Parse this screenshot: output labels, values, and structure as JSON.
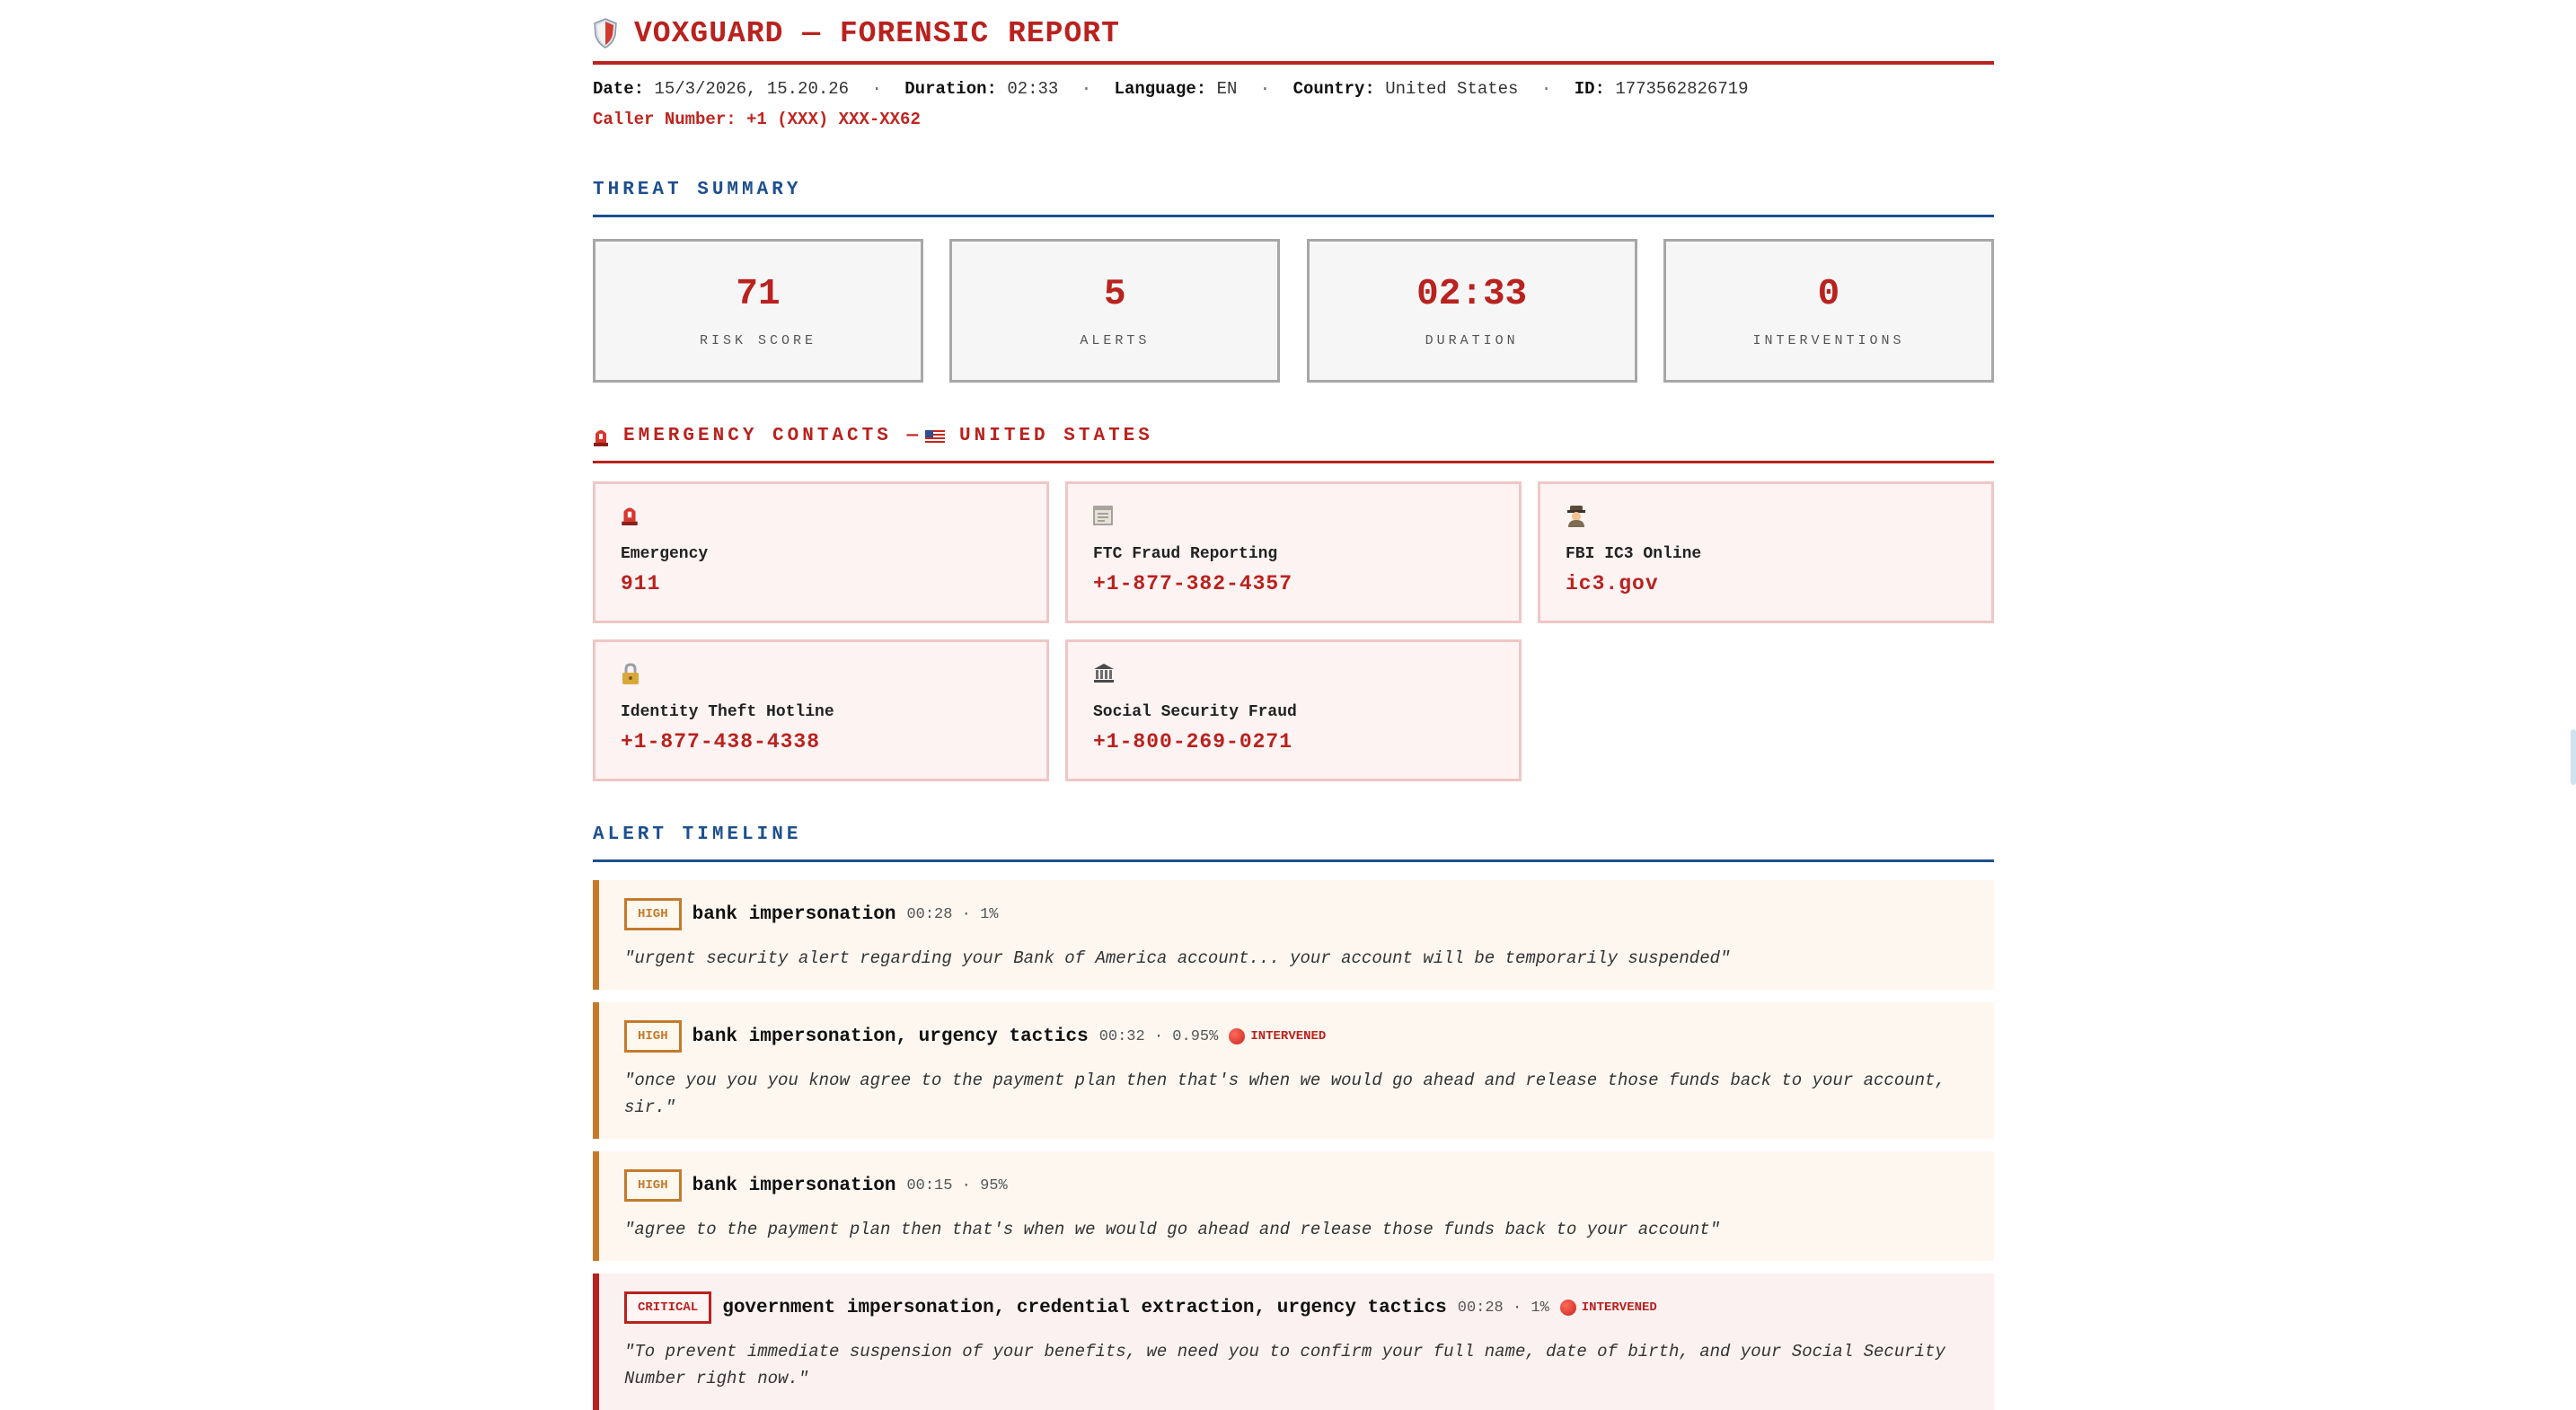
{
  "header": {
    "title": "VOXGUARD — FORENSIC REPORT",
    "meta": [
      {
        "label": "Date:",
        "value": "15/3/2026, 15.20.26"
      },
      {
        "label": "Duration:",
        "value": "02:33"
      },
      {
        "label": "Language:",
        "value": "EN"
      },
      {
        "label": "Country:",
        "value": "United States"
      },
      {
        "label": "ID:",
        "value": "1773562826719"
      }
    ],
    "separator": "·",
    "caller": "Caller Number: +1 (XXX) XXX-XX62"
  },
  "summary": {
    "heading": "THREAT SUMMARY",
    "stats": [
      {
        "value": "71",
        "label": "RISK SCORE"
      },
      {
        "value": "5",
        "label": "ALERTS"
      },
      {
        "value": "02:33",
        "label": "DURATION"
      },
      {
        "value": "0",
        "label": "INTERVENTIONS"
      }
    ]
  },
  "contacts": {
    "heading": "EMERGENCY CONTACTS — ",
    "country": "UNITED STATES",
    "items": [
      {
        "icon": "siren-icon",
        "label": "Emergency",
        "value": "911"
      },
      {
        "icon": "clipboard-icon",
        "label": "FTC Fraud Reporting",
        "value": "+1-877-382-4357"
      },
      {
        "icon": "detective-icon",
        "label": "FBI IC3 Online",
        "value": "ic3.gov"
      },
      {
        "icon": "lock-icon",
        "label": "Identity Theft Hotline",
        "value": "+1-877-438-4338"
      },
      {
        "icon": "bank-icon",
        "label": "Social Security Fraud",
        "value": "+1-800-269-0271"
      }
    ]
  },
  "timeline": {
    "heading": "ALERT TIMELINE",
    "alerts": [
      {
        "level": "HIGH",
        "type": "bank impersonation",
        "meta": "00:28 · 1%",
        "intervened": "",
        "quote": "\"urgent security alert regarding your Bank of America account... your account will be temporarily suspended\""
      },
      {
        "level": "HIGH",
        "type": "bank impersonation, urgency tactics",
        "meta": "00:32 · 0.95%",
        "intervened": "INTERVENED",
        "quote": "\"once you you you know agree to the payment plan then that's when we would go ahead and release those funds back to your account, sir.\""
      },
      {
        "level": "HIGH",
        "type": "bank impersonation",
        "meta": "00:15 · 95%",
        "intervened": "",
        "quote": "\"agree to the payment plan then that's when we would go ahead and release those funds back to your account\""
      },
      {
        "level": "CRITICAL",
        "type": "government impersonation, credential extraction, urgency tactics",
        "meta": "00:28 · 1%",
        "intervened": "INTERVENED",
        "quote": "\"To prevent immediate suspension of your benefits, we need you to confirm your full name, date of birth, and your Social Security Number right now.\""
      }
    ]
  },
  "colors": {
    "accent": "#b9221e",
    "section_blue": "#1d4f8f",
    "high": "#c57a2b"
  }
}
